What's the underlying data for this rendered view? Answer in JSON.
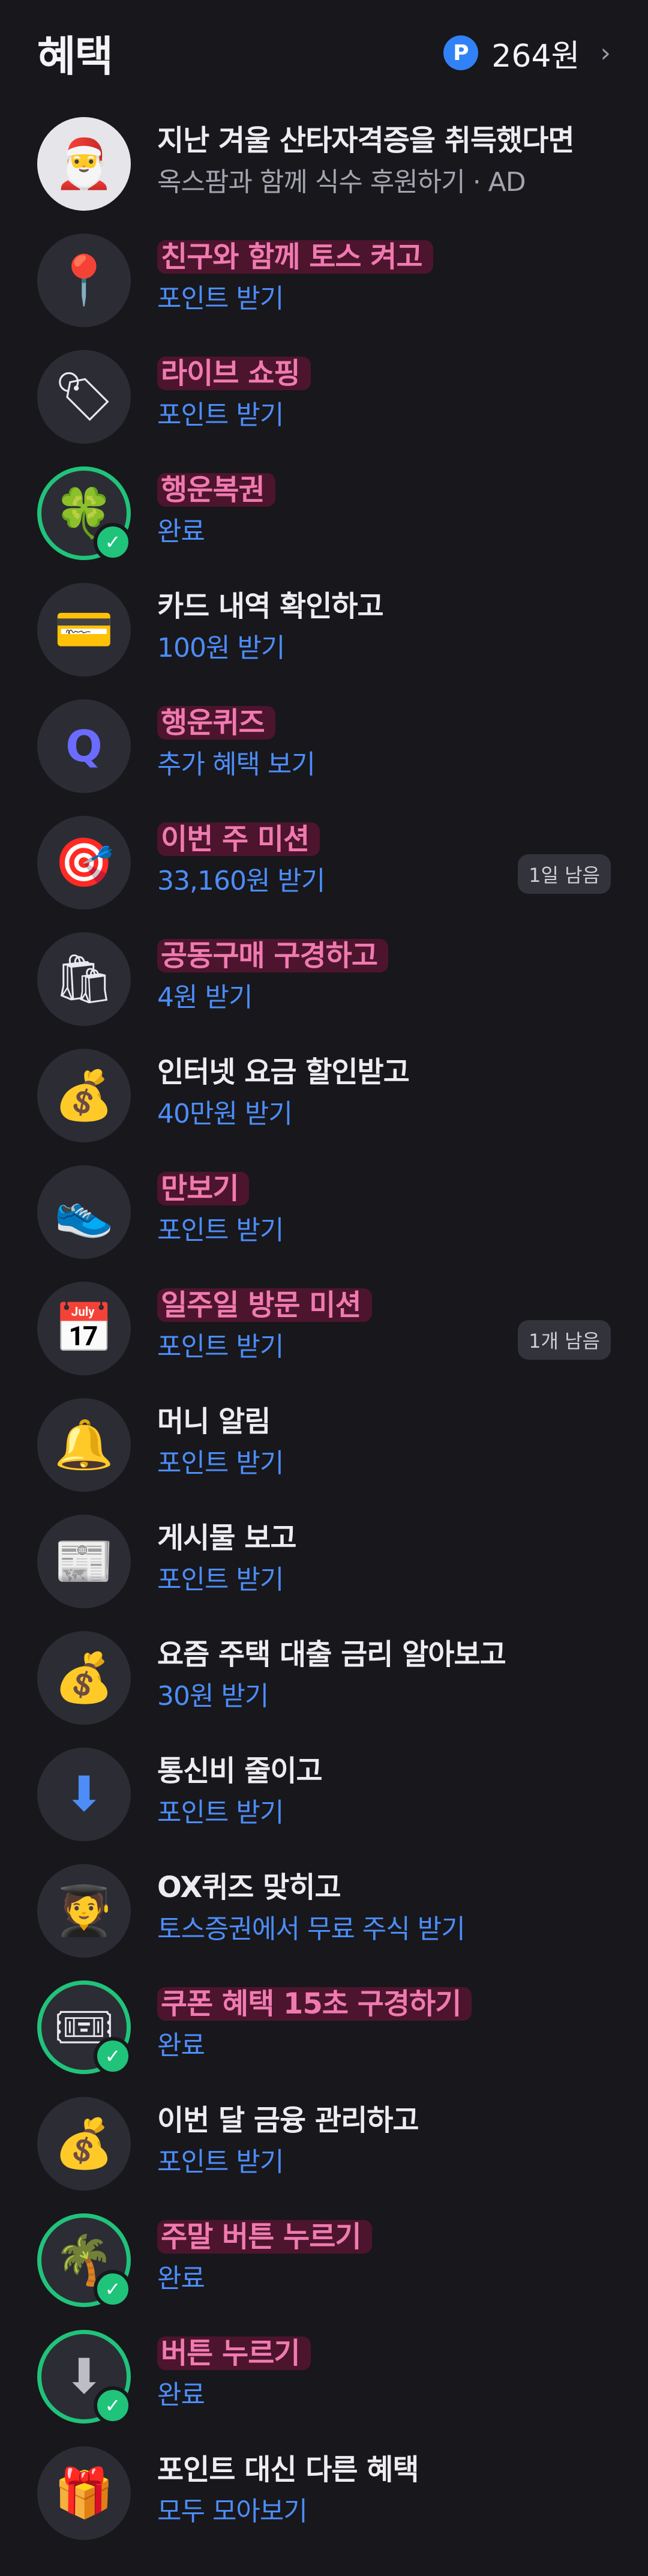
{
  "header": {
    "title": "혜택",
    "points_badge": "P",
    "points_amount": "264원",
    "chevron": "›"
  },
  "items": [
    {
      "title": "지난 겨울 산타자격증을 취득했다면",
      "sub": "옥스팜과 함께 식수 후원하기 · AD",
      "icon": "santa-icon",
      "glyph": "🎅"
    },
    {
      "title": "친구와 함께 토스 켜고",
      "sub": "포인트 받기",
      "icon": "location-pin-icon",
      "glyph": "📍"
    },
    {
      "title": "라이브 쇼핑",
      "sub": "포인트 받기",
      "icon": "live-tag-icon",
      "glyph": "🏷"
    },
    {
      "title": "행운복권",
      "sub": "완료",
      "icon": "clover-icon",
      "glyph": "🍀"
    },
    {
      "title": "카드 내역 확인하고",
      "sub": "100원 받기",
      "icon": "card-icon",
      "glyph": "💳"
    },
    {
      "title": "행운퀴즈",
      "sub": "추가 혜택 보기",
      "icon": "quiz-q-icon",
      "glyph": "Q"
    },
    {
      "title": "이번 주 미션",
      "sub": "33,160원 받기",
      "icon": "target-icon",
      "glyph": "🎯",
      "badge": "1일 남음"
    },
    {
      "title": "공동구매 구경하고",
      "sub": "4원 받기",
      "icon": "shopping-bag-icon",
      "glyph": "🛍"
    },
    {
      "title": "인터넷 요금 할인받고",
      "sub": "40만원 받기",
      "icon": "money-bag-wifi-icon",
      "glyph": "💰"
    },
    {
      "title": "만보기",
      "sub": "포인트 받기",
      "icon": "sneaker-icon",
      "glyph": "👟"
    },
    {
      "title": "일주일 방문 미션",
      "sub": "포인트 받기",
      "icon": "calendar-icon",
      "glyph": "📅",
      "badge": "1개 남음"
    },
    {
      "title": "머니 알림",
      "sub": "포인트 받기",
      "icon": "bell-icon",
      "glyph": "🔔"
    },
    {
      "title": "게시물 보고",
      "sub": "포인트 받기",
      "icon": "newspaper-icon",
      "glyph": "📰"
    },
    {
      "title": "요즘 주택 대출 금리 알아보고",
      "sub": "30원 받기",
      "icon": "money-bag-house-icon",
      "glyph": "💰"
    },
    {
      "title": "통신비 줄이고",
      "sub": "포인트 받기",
      "icon": "discount-arrow-icon",
      "glyph": "⬇"
    },
    {
      "title": "OX퀴즈 맞히고",
      "sub": "토스증권에서 무료 주식 받기",
      "icon": "graduate-icon",
      "glyph": "🧑‍🎓"
    },
    {
      "title": "쿠폰 혜택 15초 구경하기",
      "sub": "완료",
      "icon": "coupon-icon",
      "glyph": "🎟"
    },
    {
      "title": "이번 달 금융 관리하고",
      "sub": "포인트 받기",
      "icon": "money-bag-chart-icon",
      "glyph": "💰"
    },
    {
      "title": "주말 버튼 누르기",
      "sub": "완료",
      "icon": "palm-tree-icon",
      "glyph": "🌴"
    },
    {
      "title": "버튼 누르기",
      "sub": "완료",
      "icon": "down-button-icon",
      "glyph": "⬇"
    },
    {
      "title": "포인트 대신 다른 혜택",
      "sub": "모두 모아보기",
      "icon": "gift-box-icon",
      "glyph": "🎁"
    }
  ],
  "colors": {
    "background": "#17171c",
    "accent_blue": "#4d8df8",
    "highlight_pink": "#f07ab0",
    "done_green": "#20c37a"
  }
}
